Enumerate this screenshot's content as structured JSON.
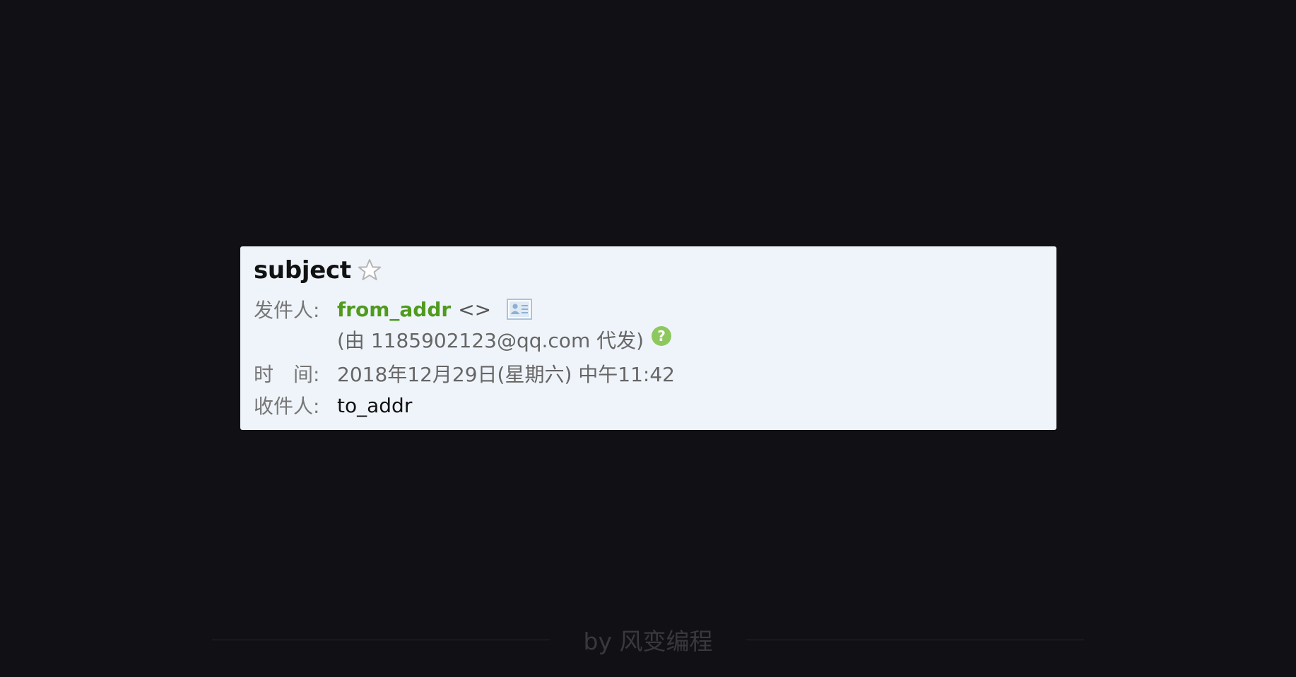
{
  "mail": {
    "subject": "subject",
    "from_label": "发件人:",
    "from_name": "from_addr",
    "from_brackets": "<>",
    "proxy_text": "(由 1185902123@qq.com 代发)",
    "time_label": "时　间:",
    "time_value": "2018年12月29日(星期六) 中午11:42",
    "to_label": "收件人:",
    "to_value": "to_addr"
  },
  "icons": {
    "star": "star-outline-icon",
    "contact_card": "contact-card-icon",
    "help": "help-icon"
  },
  "colors": {
    "page_background": "#111115",
    "card_background": "#eff4fa",
    "sender_green": "#4f9b1e",
    "help_green": "#8dc85f",
    "contact_icon_blue": "#a9c3dd"
  },
  "footer": {
    "text": "by 风变编程"
  }
}
